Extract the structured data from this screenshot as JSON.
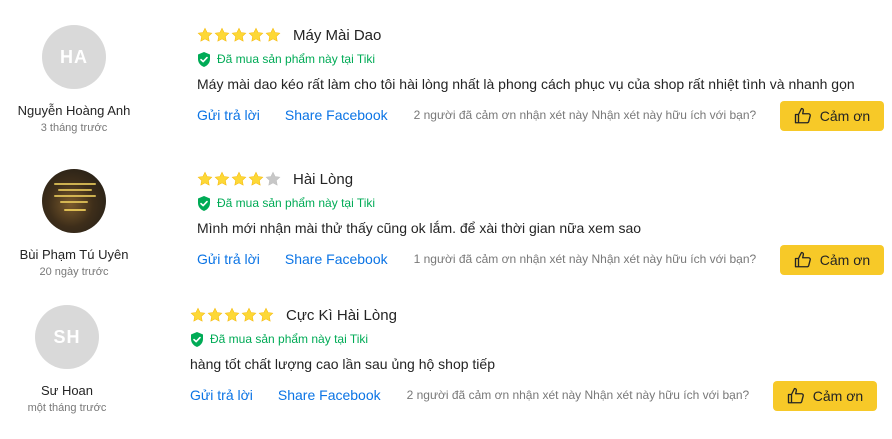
{
  "colors": {
    "star_filled": "#fdd836",
    "star_empty": "#c7c7c7",
    "verified": "#00ab56",
    "link": "#0b74e5",
    "button": "#f7c928"
  },
  "reviews": [
    {
      "avatar_initials": "HA",
      "user_name": "Nguyễn Hoàng Anh",
      "time": "3 tháng trước",
      "rating": 5,
      "title": "Máy Mài Dao",
      "verified": "Đã mua sản phẩm này tại Tiki",
      "comment": "Máy mài dao kéo rất làm cho tôi hài lòng nhất là phong cách phục vụ của shop rất nhiệt tình và nhanh gọn",
      "reply_label": "Gửi trả lời",
      "share_label": "Share Facebook",
      "thanks_text": "2 người đã cảm ơn nhận xét này Nhận xét này hữu ích với bạn?",
      "thanks_button": "Cảm ơn"
    },
    {
      "avatar_initials": "",
      "user_name": "Bùi Phạm Tú Uyên",
      "time": "20 ngày trước",
      "rating": 4,
      "title": "Hài Lòng",
      "verified": "Đã mua sản phẩm này tại Tiki",
      "comment": "Mình mới nhận mài thử thấy cũng ok lắm. để xài thời gian nữa xem sao",
      "reply_label": "Gửi trả lời",
      "share_label": "Share Facebook",
      "thanks_text": "1 người đã cảm ơn nhận xét này Nhận xét này hữu ích với bạn?",
      "thanks_button": "Cảm ơn"
    },
    {
      "avatar_initials": "SH",
      "user_name": "Sư Hoan",
      "time": "một tháng trước",
      "rating": 5,
      "title": "Cực Kì Hài Lòng",
      "verified": "Đã mua sản phẩm này tại Tiki",
      "comment": "hàng tốt chất lượng cao lần sau ủng hộ shop tiếp",
      "reply_label": "Gửi trả lời",
      "share_label": "Share Facebook",
      "thanks_text": "2 người đã cảm ơn nhận xét này Nhận xét này hữu ích với bạn?",
      "thanks_button": "Cảm ơn"
    }
  ]
}
